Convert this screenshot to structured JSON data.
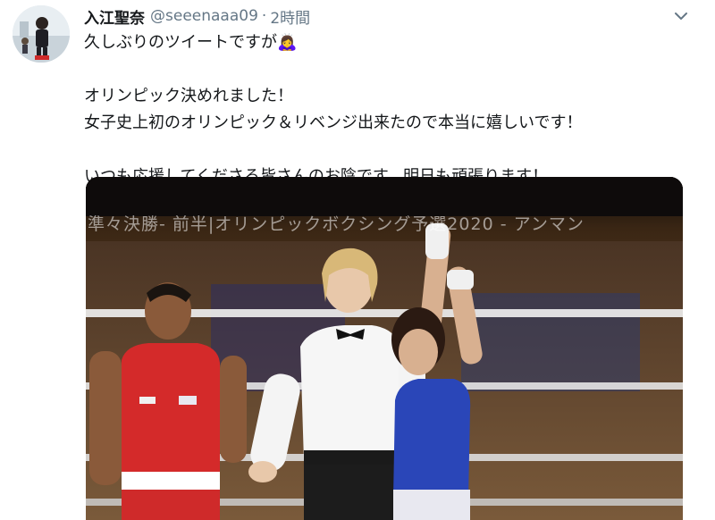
{
  "tweet": {
    "name": "入江聖奈",
    "handle": "@seeenaaa09",
    "separator": "·",
    "time": "2時間",
    "lines": [
      "久しぶりのツイートですが🙇‍♀️",
      "",
      "オリンピック決めれました！",
      "女子史上初のオリンピック＆リベンジ出来たので本当に嬉しいです！",
      "",
      "いつも応援してくださる皆さんのお陰です。明日も頑張ります！"
    ]
  },
  "media": {
    "banner_text": "準々決勝- 前半|オリンピックボクシング予選2020 - アンマン"
  },
  "icons": {
    "avatar": "avatar-photo",
    "menu": "chevron-down-icon",
    "emoji": "bowing-person-emoji"
  },
  "colors": {
    "text": "#14171a",
    "secondary": "#657786",
    "red_corner": "#d42a2a",
    "blue_corner": "#2a46b8"
  }
}
